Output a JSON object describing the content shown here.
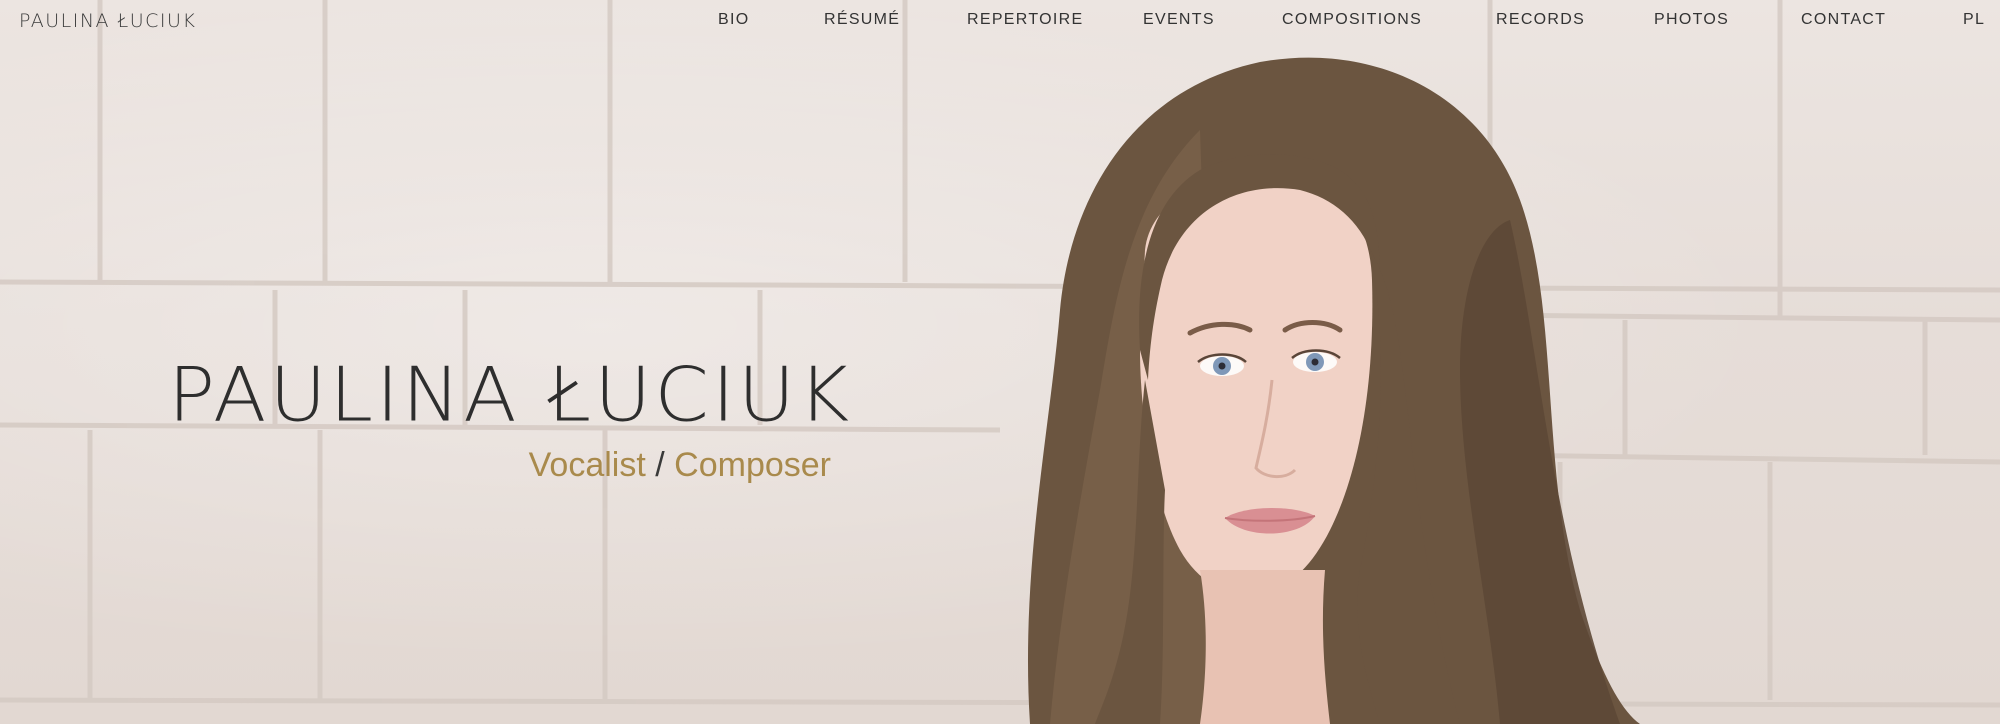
{
  "site": {
    "logo": "PAULINA ŁUCIUK"
  },
  "nav": {
    "items": [
      {
        "label": "BIO"
      },
      {
        "label": "RÉSUMÉ"
      },
      {
        "label": "REPERTOIRE"
      },
      {
        "label": "EVENTS"
      },
      {
        "label": "COMPOSITIONS"
      },
      {
        "label": "RECORDS"
      },
      {
        "label": "PHOTOS"
      },
      {
        "label": "CONTACT"
      },
      {
        "label": "PL"
      }
    ]
  },
  "hero": {
    "title": "PAULINA ŁUCIUK",
    "role_1": "Vocalist",
    "separator": " / ",
    "role_2": "Composer"
  },
  "colors": {
    "accent": "#a98a4c",
    "text": "#333333",
    "background": "#e9e1dc"
  }
}
